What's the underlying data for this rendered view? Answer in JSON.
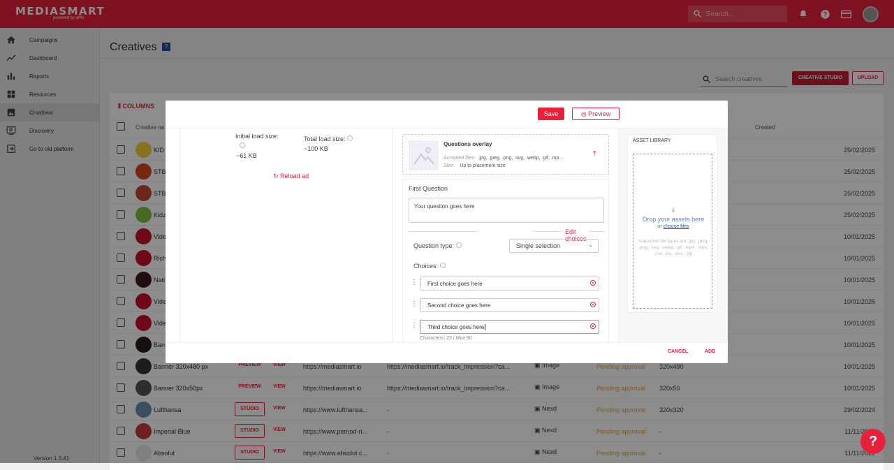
{
  "app": {
    "logo": "MEDIASMART",
    "logo_sub": "powered by affle"
  },
  "topbar": {
    "search_placeholder": "Search..."
  },
  "sidebar": {
    "items": [
      {
        "label": "Campaigns",
        "icon": "home-icon"
      },
      {
        "label": "Dashboard",
        "icon": "trend-icon"
      },
      {
        "label": "Reports",
        "icon": "bar-chart-icon"
      },
      {
        "label": "Resources",
        "icon": "grid-icon"
      },
      {
        "label": "Creatives",
        "icon": "image-icon"
      },
      {
        "label": "Discovery",
        "icon": "discovery-icon"
      },
      {
        "label": "Go to old platform",
        "icon": "exit-icon"
      }
    ],
    "version": "Version 1.3.41"
  },
  "page": {
    "title": "Creatives",
    "search_placeholder": "Search creatives",
    "creative_studio": "CREATIVE STUDIO",
    "upload": "UPLOAD",
    "columns": "COLUMNS",
    "headers": {
      "name": "Creative na",
      "created": "Created"
    }
  },
  "rows": [
    {
      "name": "KID",
      "action1": "",
      "action2": "",
      "url": "",
      "track": "",
      "type": "",
      "status": "",
      "size": "",
      "date": "25/02/2025",
      "color": "#f4d23b"
    },
    {
      "name": "STB",
      "action1": "",
      "action2": "",
      "url": "",
      "track": "",
      "type": "",
      "status": "",
      "size": "",
      "date": "25/02/2025",
      "color": "#d8491c"
    },
    {
      "name": "STB",
      "action1": "",
      "action2": "",
      "url": "",
      "track": "",
      "type": "",
      "status": "",
      "size": "",
      "date": "25/02/2025",
      "color": "#c04a2a"
    },
    {
      "name": "Kidz",
      "action1": "",
      "action2": "",
      "url": "",
      "track": "",
      "type": "",
      "status": "",
      "size": "",
      "date": "25/02/2025",
      "color": "#7fbf3f"
    },
    {
      "name": "Vide",
      "action1": "",
      "action2": "",
      "url": "",
      "track": "",
      "type": "",
      "status": "",
      "size": "",
      "date": "10/01/2025",
      "color": "#c8102e"
    },
    {
      "name": "Rich",
      "action1": "",
      "action2": "",
      "url": "",
      "track": "",
      "type": "",
      "status": "",
      "size": "",
      "date": "10/01/2025",
      "color": "#c8102e"
    },
    {
      "name": "Nati",
      "action1": "",
      "action2": "",
      "url": "",
      "track": "",
      "type": "",
      "status": "",
      "size": "",
      "date": "10/01/2025",
      "color": "#3a1d1d"
    },
    {
      "name": "Vide",
      "action1": "",
      "action2": "",
      "url": "",
      "track": "",
      "type": "",
      "status": "",
      "size": "",
      "date": "10/01/2025",
      "color": "#c8102e"
    },
    {
      "name": "Vide",
      "action1": "",
      "action2": "",
      "url": "",
      "track": "",
      "type": "",
      "status": "",
      "size": "",
      "date": "10/01/2025",
      "color": "#c8102e"
    },
    {
      "name": "Ban",
      "action1": "",
      "action2": "",
      "url": "",
      "track": "",
      "type": "",
      "status": "",
      "size": "",
      "date": "10/01/2025",
      "color": "#2a1a1a"
    },
    {
      "name": "Banner 320x480 px",
      "action1": "PREVIEW",
      "action2": "VIEW",
      "url": "https://mediasmart.io",
      "track": "https://mediasmart.io/track_impression?ca...",
      "type": "Image",
      "status": "Pending approval",
      "size": "320x480",
      "date": "10/01/2025",
      "color": "#333"
    },
    {
      "name": "Banner 320x50px",
      "action1": "PREVIEW",
      "action2": "VIEW",
      "url": "https://mediasmart.io",
      "track": "https://mediasmart.io/track_impression?ca...",
      "type": "Image",
      "status": "Pending approval",
      "size": "320x50",
      "date": "10/01/2025",
      "color": "#555"
    },
    {
      "name": "Lufthansa",
      "action1": "STUDIO",
      "action2": "VIEW",
      "url": "https://www.lufthansa...",
      "track": "-",
      "type": "Nexd",
      "status": "Pending approval",
      "size": "320x320",
      "date": "29/02/2024",
      "color": "#6a8fb3"
    },
    {
      "name": "Imperial Blue",
      "action1": "STUDIO",
      "action2": "VIEW",
      "url": "https://www.pernod-ri...",
      "track": "-",
      "type": "Nexd",
      "status": "Pending approval",
      "size": "-",
      "date": "11/11/2022",
      "color": "#c83a3a"
    },
    {
      "name": "Absolut",
      "action1": "STUDIO",
      "action2": "VIEW",
      "url": "https://www.absolut.c...",
      "track": "-",
      "type": "Nexd",
      "status": "Pending approval",
      "size": "-",
      "date": "11/11/2022",
      "color": "#e8e8e8"
    }
  ],
  "modal": {
    "save": "Save",
    "preview": "Preview",
    "initial_load_label": "Initial load size:",
    "initial_load_value": "~61 KB",
    "total_load_label": "Total load size:",
    "total_load_value": "~100 KB",
    "reload": "Reload ad",
    "upload": {
      "title": "Questions overlay",
      "accepted_label": "Accepted files:",
      "accepted_value": ".jpg, .jpeg, .png, .svg, .webp, .gif, .mp...",
      "size_label": "Size:",
      "size_value": "Up to placement size"
    },
    "question_title": "First Question",
    "question_placeholder": "Your question goes here",
    "edit_choices": "Edit choices",
    "question_type_label": "Question type:",
    "question_type_value": "Single selection",
    "choices_label": "Choices:",
    "choices": [
      "First choice goes here",
      "Second choice goes here",
      "Third choice goes here"
    ],
    "char_count": "Characters: 22 / Max 90",
    "asset_library": "ASSET LIBRARY",
    "drop_text": "Drop your assets here",
    "drop_or": "or",
    "drop_link": "choose files",
    "supported": "Supported file types are .jpg, .jpeg, .png, .svg, .webp, .gif, .mp4, .mov, .csv, .xls, .xlsx, .zip",
    "cancel": "CANCEL",
    "add": "ADD"
  }
}
